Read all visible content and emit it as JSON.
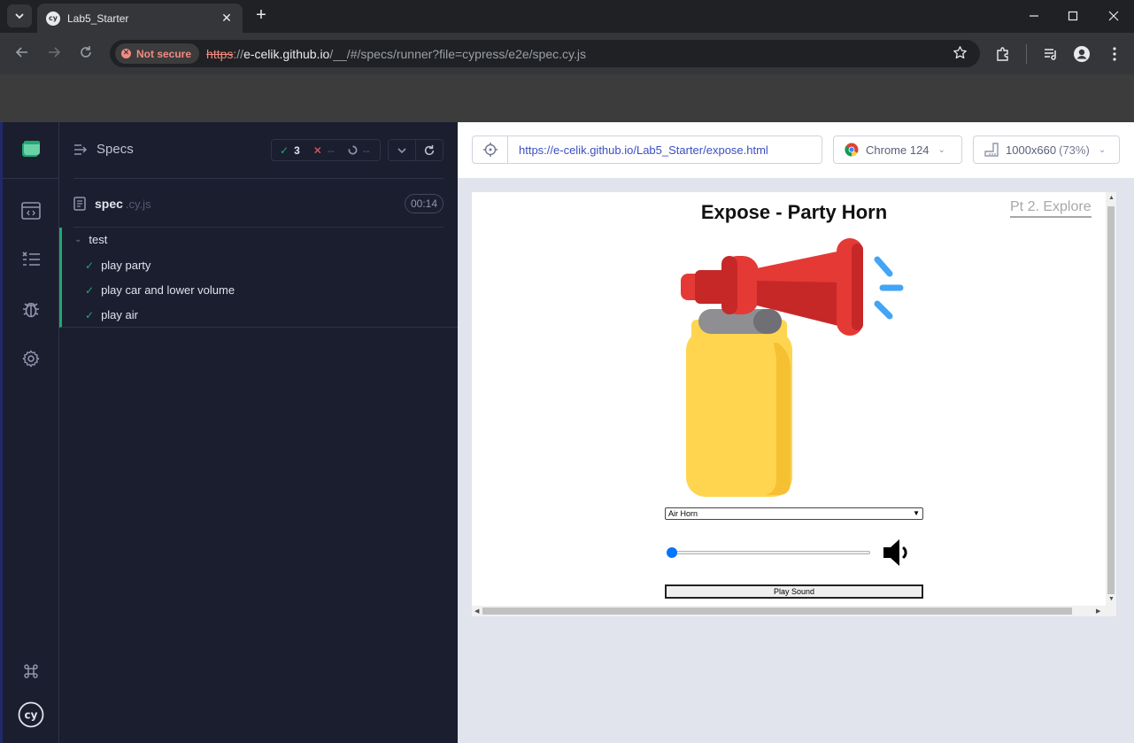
{
  "browser": {
    "tab_title": "Lab5_Starter",
    "tab_favicon_text": "cy",
    "close_glyph": "✕",
    "new_tab_glyph": "+",
    "security_chip": "Not secure",
    "url_scheme": "https",
    "url_sep": "://",
    "url_host": "e-celik.github.io",
    "url_path": "/__/#/specs/runner?file=cypress/e2e/spec.cy.js"
  },
  "reporter": {
    "specs_label": "Specs",
    "passed_count": "3",
    "failed_count": "--",
    "pending_count": "--",
    "spec_name": "spec",
    "spec_ext": ".cy.js",
    "duration": "00:14",
    "suite_title": "test",
    "tests": [
      {
        "title": "play party",
        "state": "passed"
      },
      {
        "title": "play car and lower volume",
        "state": "passed"
      },
      {
        "title": "play air",
        "state": "passed"
      }
    ]
  },
  "aut": {
    "url": "https://e-celik.github.io/Lab5_Starter/expose.html",
    "browser_label": "Chrome 124",
    "viewport_size": "1000x660",
    "viewport_scale": "(73%)"
  },
  "page": {
    "title": "Expose - Party Horn",
    "link": "Pt 2. Explore",
    "horn_select": "Air Horn",
    "volume_fraction": 0.0,
    "play_button": "Play Sound"
  },
  "colors": {
    "cypress_green": "#1fa971",
    "cypress_red": "#ef5e5e",
    "slider_accent": "#0075ff"
  }
}
